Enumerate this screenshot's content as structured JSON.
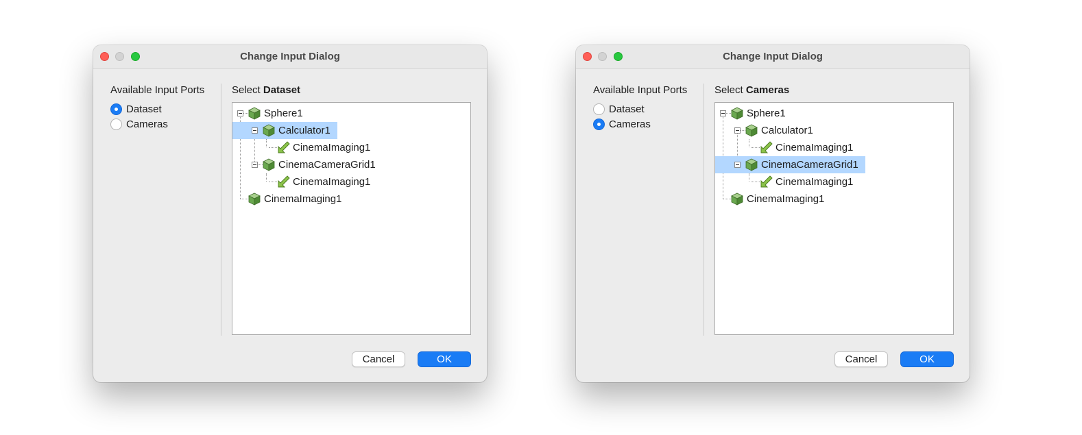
{
  "dialogs": [
    {
      "title": "Change Input Dialog",
      "ports_label": "Available Input Ports",
      "ports": [
        {
          "label": "Dataset",
          "checked": true
        },
        {
          "label": "Cameras",
          "checked": false
        }
      ],
      "select_prefix": "Select",
      "select_port": "Dataset",
      "tree": [
        {
          "label": "Sphere1",
          "depth": 0,
          "icon": "cube-icon",
          "expander": true,
          "selected": false
        },
        {
          "label": "Calculator1",
          "depth": 1,
          "icon": "cube-icon",
          "expander": true,
          "selected": true
        },
        {
          "label": "CinemaImaging1",
          "depth": 2,
          "icon": "arrow-icon",
          "expander": false,
          "selected": false
        },
        {
          "label": "CinemaCameraGrid1",
          "depth": 1,
          "icon": "cube-icon",
          "expander": true,
          "selected": false
        },
        {
          "label": "CinemaImaging1",
          "depth": 2,
          "icon": "arrow-icon",
          "expander": false,
          "selected": false
        },
        {
          "label": "CinemaImaging1",
          "depth": 0,
          "icon": "cube-icon",
          "expander": false,
          "selected": false
        }
      ],
      "cancel_label": "Cancel",
      "ok_label": "OK"
    },
    {
      "title": "Change Input Dialog",
      "ports_label": "Available Input Ports",
      "ports": [
        {
          "label": "Dataset",
          "checked": false
        },
        {
          "label": "Cameras",
          "checked": true
        }
      ],
      "select_prefix": "Select",
      "select_port": "Cameras",
      "tree": [
        {
          "label": "Sphere1",
          "depth": 0,
          "icon": "cube-icon",
          "expander": true,
          "selected": false
        },
        {
          "label": "Calculator1",
          "depth": 1,
          "icon": "cube-icon",
          "expander": true,
          "selected": false
        },
        {
          "label": "CinemaImaging1",
          "depth": 2,
          "icon": "arrow-icon",
          "expander": false,
          "selected": false
        },
        {
          "label": "CinemaCameraGrid1",
          "depth": 1,
          "icon": "cube-icon",
          "expander": true,
          "selected": true
        },
        {
          "label": "CinemaImaging1",
          "depth": 2,
          "icon": "arrow-icon",
          "expander": false,
          "selected": false
        },
        {
          "label": "CinemaImaging1",
          "depth": 0,
          "icon": "cube-icon",
          "expander": false,
          "selected": false
        }
      ],
      "cancel_label": "Cancel",
      "ok_label": "OK"
    }
  ],
  "colors": {
    "accent": "#1a7cf5",
    "selection": "#b3d7ff",
    "cube": "#6aa84f",
    "arrow": "#8cc34a"
  }
}
